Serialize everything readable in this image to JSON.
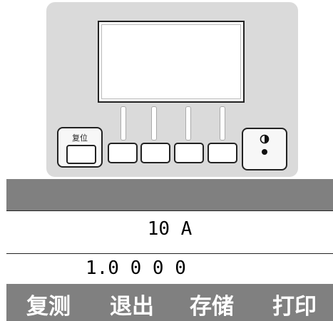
{
  "device": {
    "reset_label": "复位"
  },
  "display": {
    "current": "10 A",
    "value": "1.0 0 0 0"
  },
  "softkeys": [
    {
      "label": "复测"
    },
    {
      "label": "退出"
    },
    {
      "label": "存储"
    },
    {
      "label": "打印"
    }
  ],
  "colors": {
    "panel": "#dadada",
    "band": "#808080",
    "softkey_text": "#ffffff"
  },
  "icons": {
    "contrast": "contrast-icon"
  }
}
